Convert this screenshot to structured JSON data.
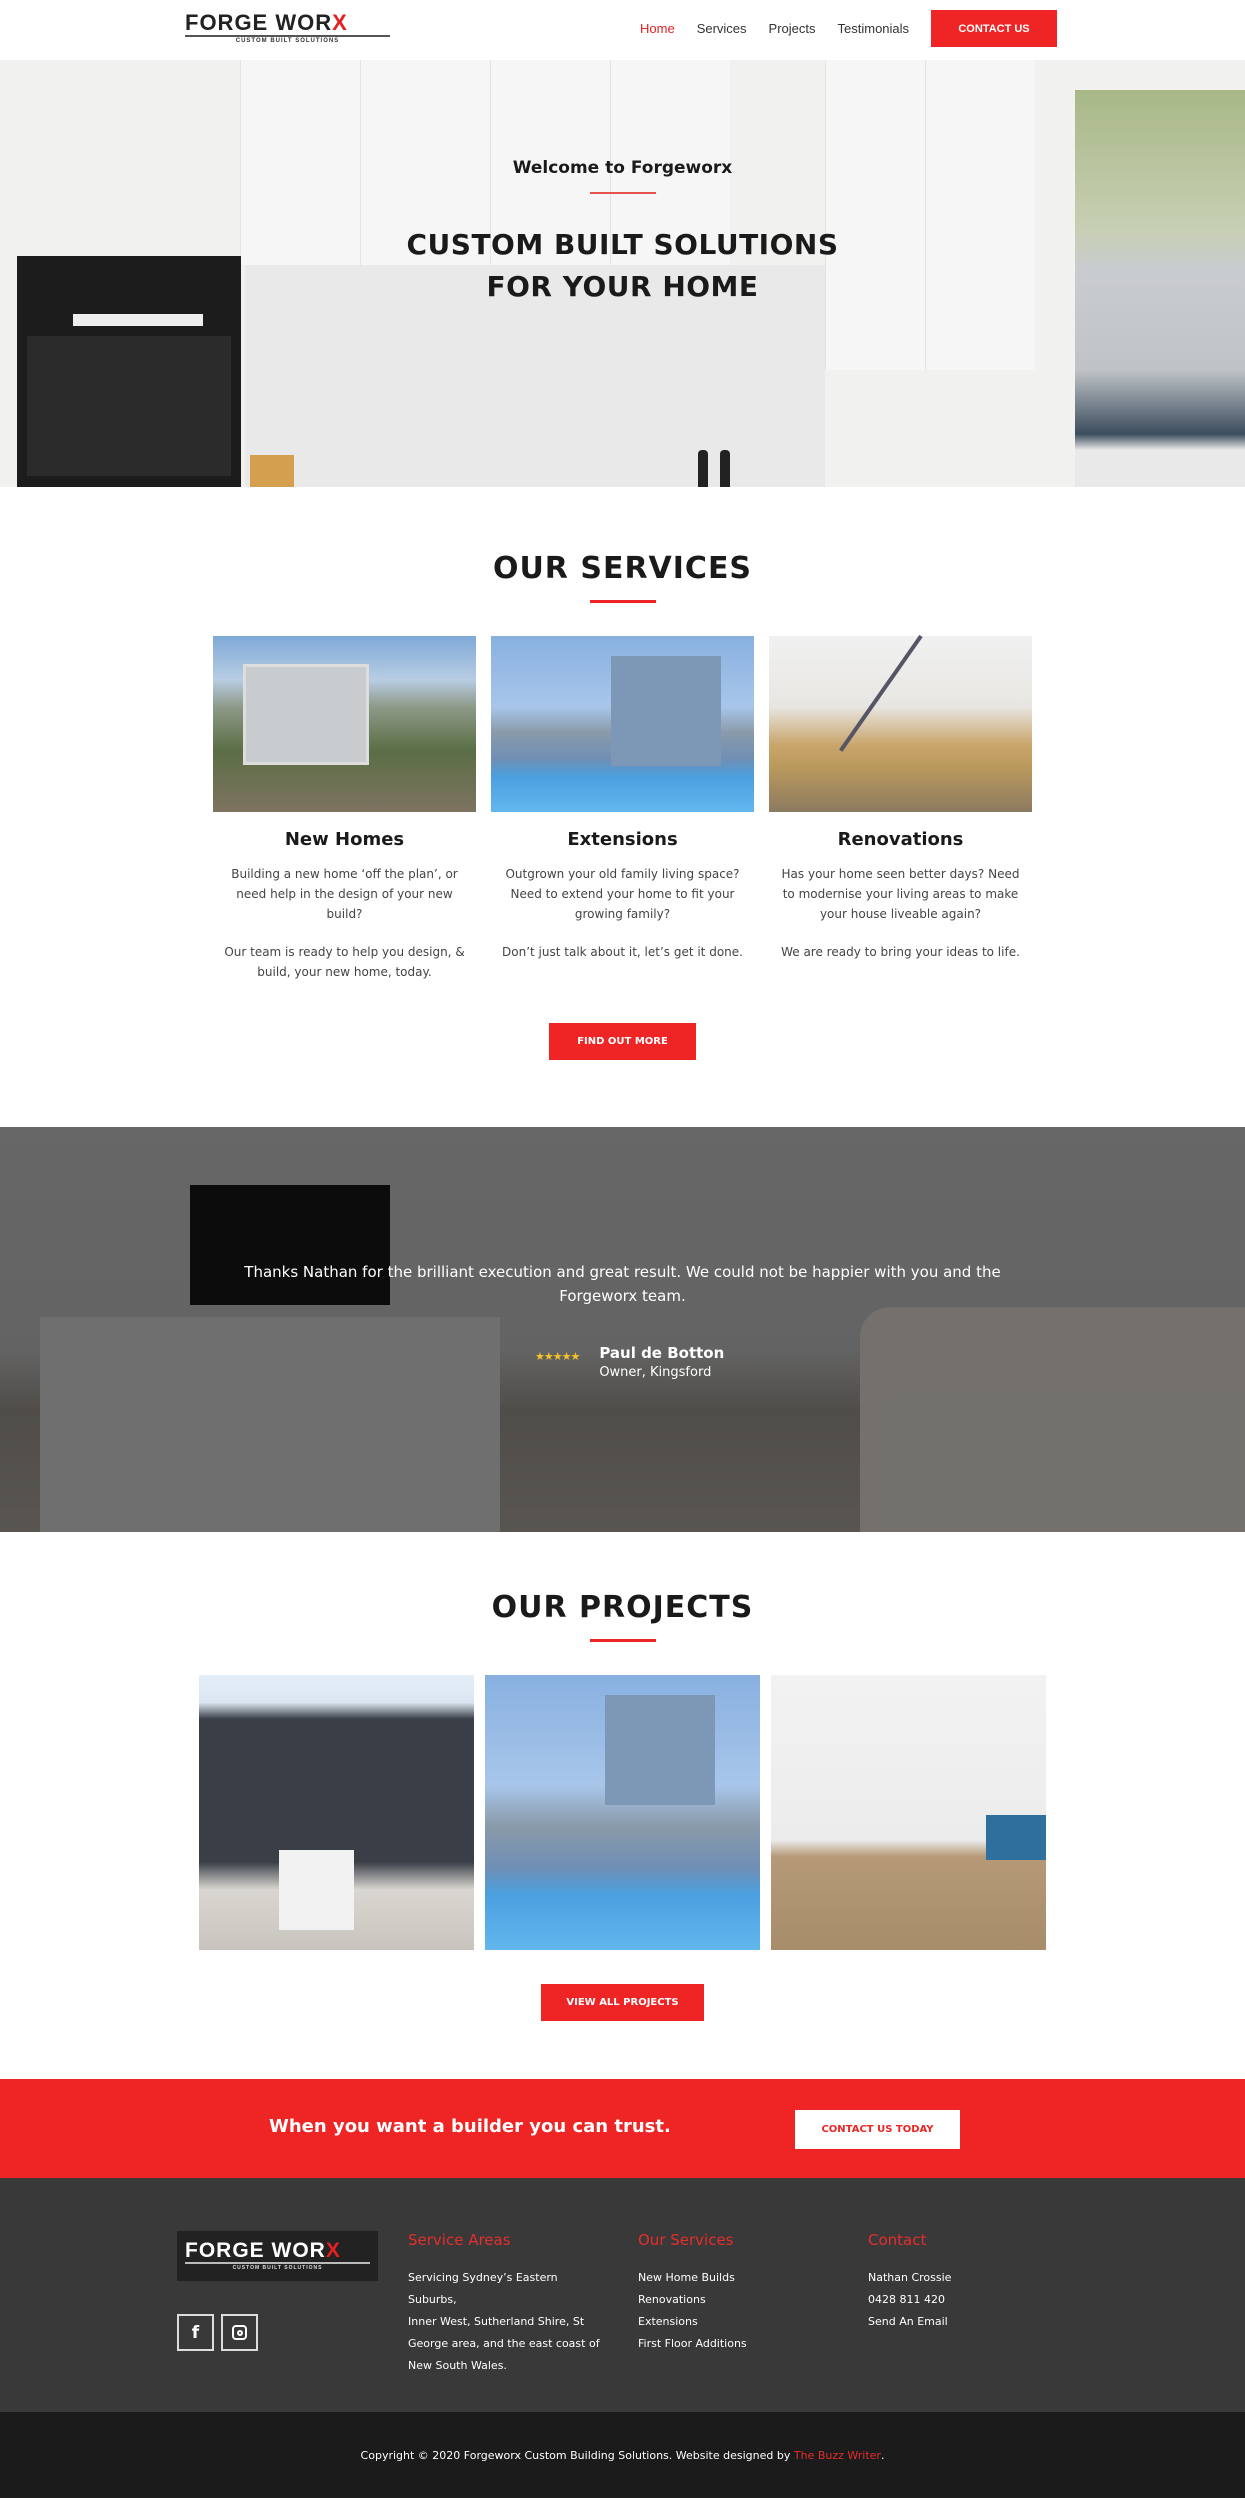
{
  "header": {
    "logo": {
      "word_main": "FORGE WOR",
      "word_accent": "X",
      "tagline": "CUSTOM BUILT SOLUTIONS"
    },
    "nav": [
      {
        "label": "Home",
        "active": true
      },
      {
        "label": "Services",
        "active": false
      },
      {
        "label": "Projects",
        "active": false
      },
      {
        "label": "Testimonials",
        "active": false
      }
    ],
    "contact_button": "CONTACT US"
  },
  "hero": {
    "welcome": "Welcome to Forgeworx",
    "headline_line1": "CUSTOM BUILT SOLUTIONS",
    "headline_line2": "FOR YOUR HOME"
  },
  "services": {
    "title": "OUR SERVICES",
    "items": [
      {
        "title": "New Homes",
        "image": "new-home-photo",
        "p1": "Building a new home ‘off the plan’, or need help in the design of your new build?",
        "p2": "Our team is ready to help you design, & build, your new home, today."
      },
      {
        "title": "Extensions",
        "image": "extension-pool-photo",
        "p1": "Outgrown your old family living space? Need to extend your home to fit your growing family?",
        "p2": "Don’t just talk about it, let’s get it done."
      },
      {
        "title": "Renovations",
        "image": "renovated-living-room-photo",
        "p1": "Has your home seen better days? Need to modernise your living areas to make your house liveable again?",
        "p2": "We are ready to bring your ideas to life."
      }
    ],
    "button": "FIND OUT MORE"
  },
  "testimonial": {
    "quote": "Thanks Nathan for the brilliant execution and great result. We could not be happier with you and the Forgeworx team.",
    "rating": 5,
    "stars": "★★★★★",
    "author": "Paul de Botton",
    "role": "Owner, Kingsford"
  },
  "projects": {
    "title": "OUR PROJECTS",
    "items": [
      {
        "image": "dark-brick-house-photo"
      },
      {
        "image": "pool-backyard-photo"
      },
      {
        "image": "kitchen-living-photo"
      }
    ],
    "button": "VIEW ALL PROJECTS"
  },
  "cta": {
    "text": "When you want a builder you can trust.",
    "button": "CONTACT US TODAY"
  },
  "footer": {
    "logo": {
      "word_main": "FORGE WOR",
      "word_accent": "X",
      "tagline": "CUSTOM BUILT SOLUTIONS"
    },
    "social": [
      {
        "name": "facebook",
        "glyph": "f"
      },
      {
        "name": "instagram",
        "glyph": ""
      }
    ],
    "service_areas": {
      "title": "Service Areas",
      "lines": [
        "Servicing Sydney’s Eastern Suburbs,",
        "Inner West, Sutherland Shire, St",
        "George area, and the east coast of",
        "New South Wales."
      ]
    },
    "our_services": {
      "title": "Our Services",
      "links": [
        "New Home Builds",
        "Renovations",
        "Extensions",
        "First Floor Additions"
      ]
    },
    "contact": {
      "title": "Contact",
      "name": "Nathan Crossie",
      "phone": "0428 811 420",
      "email_link": "Send An Email"
    },
    "copyright": "Copyright © 2020 Forgeworx Custom Building Solutions. Website designed by ",
    "designer_link": "The Buzz Writer",
    "copyright_end": "."
  },
  "colors": {
    "accent": "#ee2524",
    "footer_bg": "#393939",
    "bottom_bar_bg": "#1b1b1b",
    "heading_text": "#1a1a1a"
  }
}
